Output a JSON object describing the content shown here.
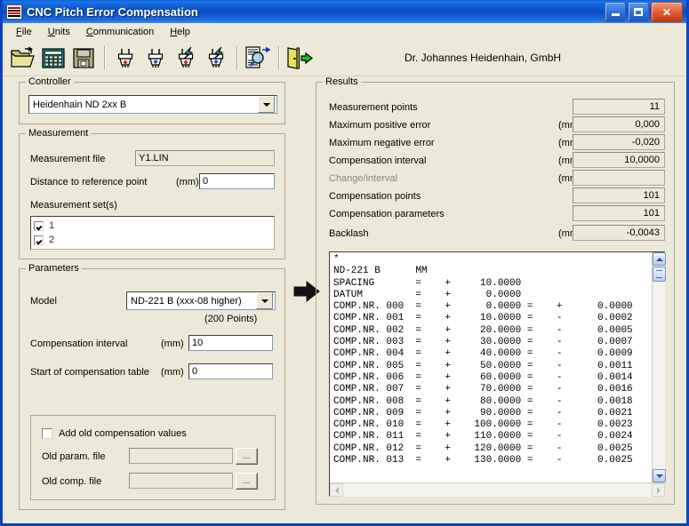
{
  "window": {
    "title": "CNC Pitch Error Compensation",
    "icon": "app-icon",
    "buttons": {
      "minimize": "–",
      "maximize": "□",
      "close": "✕"
    }
  },
  "menu": {
    "items": [
      {
        "label": "File",
        "accel": "F"
      },
      {
        "label": "Units",
        "accel": "U"
      },
      {
        "label": "Communication",
        "accel": "C"
      },
      {
        "label": "Help",
        "accel": "H"
      }
    ]
  },
  "toolbar": {
    "buttons": [
      {
        "name": "open-file-icon",
        "title": "Open"
      },
      {
        "name": "calculator-icon",
        "title": "Calculate"
      },
      {
        "name": "save-diskette-icon",
        "title": "Save"
      },
      {
        "name": "plug-upload-red-icon",
        "title": "Send"
      },
      {
        "name": "plug-download-blue-icon",
        "title": "Receive"
      },
      {
        "name": "plug-upload-fast-red-icon",
        "title": "Send fast"
      },
      {
        "name": "plug-download-fast-blue-icon",
        "title": "Receive fast"
      },
      {
        "name": "document-preview-icon",
        "title": "Preview"
      },
      {
        "name": "exit-door-icon",
        "title": "Exit"
      }
    ],
    "company": "Dr. Johannes Heidenhain, GmbH"
  },
  "controller": {
    "legend": "Controller",
    "selected": "Heidenhain ND 2xx B"
  },
  "measurement": {
    "legend": "Measurement",
    "file_label": "Measurement file",
    "file_value": "Y1.LIN",
    "distance_label": "Distance to reference point",
    "distance_unit": "(mm)",
    "distance_value": "0",
    "sets_label": "Measurement set(s)",
    "sets": [
      {
        "label": "1",
        "checked": true
      },
      {
        "label": "2",
        "checked": true
      }
    ]
  },
  "parameters": {
    "legend": "Parameters",
    "model_label": "Model",
    "model_value": "ND-221 B (xxx-08 higher)",
    "points_note": "(200  Points)",
    "interval_label": "Compensation interval",
    "interval_unit": "(mm)",
    "interval_value": "10",
    "start_label": "Start of compensation table",
    "start_unit": "(mm)",
    "start_value": "0",
    "add_old_label": "Add old compensation values",
    "add_old_checked": false,
    "old_param_label": "Old  param. file",
    "old_param_value": "",
    "old_comp_label": "Old  comp. file",
    "old_comp_value": "",
    "browse_label": "..."
  },
  "results": {
    "legend": "Results",
    "rows": [
      {
        "label": "Measurement points",
        "unit": "",
        "value": "11",
        "disabled": false
      },
      {
        "label": "Maximum positive error",
        "unit": "(mm)",
        "value": "0,000",
        "disabled": false
      },
      {
        "label": "Maximum negative error",
        "unit": "(mm)",
        "value": "-0,020",
        "disabled": false
      },
      {
        "label": "Compensation interval",
        "unit": "(mm)",
        "value": "10,0000",
        "disabled": false
      },
      {
        "label": "Change/interval",
        "unit": "(mm)",
        "value": "",
        "disabled": true
      },
      {
        "label": "Compensation points",
        "unit": "",
        "value": "101",
        "disabled": false
      },
      {
        "label": "Compensation parameters",
        "unit": "",
        "value": "101",
        "disabled": false
      },
      {
        "label": "Backlash",
        "unit": "(mm)",
        "value": "-0,0043",
        "disabled": false
      }
    ]
  },
  "listing": {
    "text": "*\nND-221 B      MM\nSPACING       =    +     10.0000\nDATUM         =    +      0.0000\nCOMP.NR. 000  =    +      0.0000 =    +      0.0000\nCOMP.NR. 001  =    +     10.0000 =    -      0.0002\nCOMP.NR. 002  =    +     20.0000 =    -      0.0005\nCOMP.NR. 003  =    +     30.0000 =    -      0.0007\nCOMP.NR. 004  =    +     40.0000 =    -      0.0009\nCOMP.NR. 005  =    +     50.0000 =    -      0.0011\nCOMP.NR. 006  =    +     60.0000 =    -      0.0014\nCOMP.NR. 007  =    +     70.0000 =    -      0.0016\nCOMP.NR. 008  =    +     80.0000 =    -      0.0018\nCOMP.NR. 009  =    +     90.0000 =    -      0.0021\nCOMP.NR. 010  =    +    100.0000 =    -      0.0023\nCOMP.NR. 011  =    +    110.0000 =    -      0.0024\nCOMP.NR. 012  =    +    120.0000 =    -      0.0025\nCOMP.NR. 013  =    +    130.0000 =    -      0.0025"
  },
  "colors": {
    "face": "#ece9d8",
    "frame": "#0a44c0",
    "title_gradient_start": "#0a62d6",
    "accent_red": "#cc0000",
    "accent_blue": "#1a4fd0",
    "scroll_blue": "#b8cdee"
  }
}
